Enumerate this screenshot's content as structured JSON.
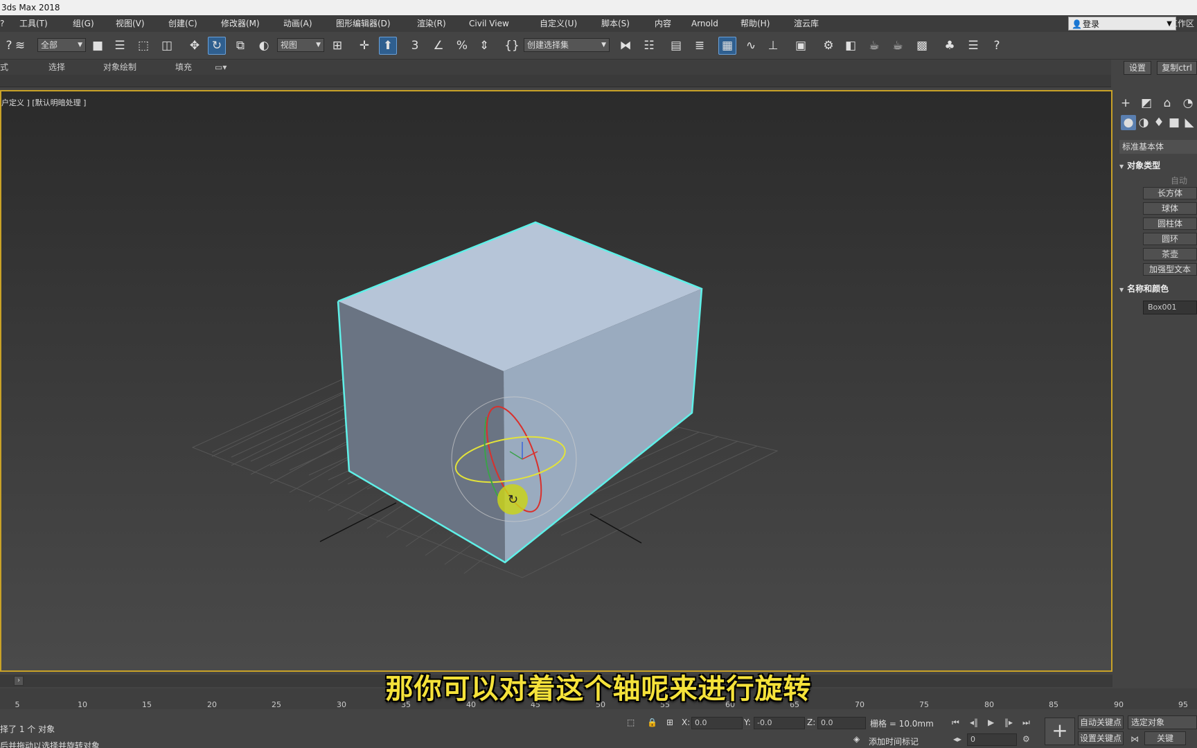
{
  "app": {
    "title": "3ds Max 2018"
  },
  "menu": [
    {
      "label": "工具(T)"
    },
    {
      "label": "组(G)"
    },
    {
      "label": "视图(V)"
    },
    {
      "label": "创建(C)"
    },
    {
      "label": "修改器(M)"
    },
    {
      "label": "动画(A)"
    },
    {
      "label": "图形编辑器(D)"
    },
    {
      "label": "渲染(R)"
    },
    {
      "label": "Civil View"
    },
    {
      "label": "自定义(U)"
    },
    {
      "label": "脚本(S)"
    },
    {
      "label": "内容"
    },
    {
      "label": "Arnold"
    },
    {
      "label": "帮助(H)"
    },
    {
      "label": "渲云库"
    }
  ],
  "account": {
    "login_label": "登录",
    "workspace_label": "工作区"
  },
  "toolbar": {
    "selection_filter": "全部",
    "ref_coord": "视图",
    "named_selection": "创建选择集"
  },
  "ribbon": {
    "tabs": [
      "式",
      "选择",
      "对象绘制",
      "填充"
    ],
    "settings_label": "设置",
    "copy_label": "复制ctrl"
  },
  "viewport": {
    "label": "户定义 ] [默认明暗处理 ]"
  },
  "command_panel": {
    "category": "标准基本体",
    "object_type_title": "对象类型",
    "autogrid_label": "自动",
    "objects": [
      "长方体",
      "球体",
      "圆柱体",
      "圆环",
      "茶壶",
      "加强型文本"
    ],
    "name_color_title": "名称和颜色",
    "object_name": "Box001"
  },
  "timeline": {
    "ticks": [
      "5",
      "10",
      "15",
      "20",
      "25",
      "30",
      "35",
      "40",
      "45",
      "50",
      "55",
      "60",
      "65",
      "70",
      "75",
      "80",
      "85",
      "90",
      "95"
    ]
  },
  "subtitle": "那你可以对着这个轴呢来进行旋转",
  "status": {
    "selected": "择了 1 个 对象",
    "prompt": "后并拖动以选择并旋转对象",
    "x_label": "X:",
    "x_value": "0.0",
    "y_label": "Y:",
    "y_value": "-0.0",
    "z_label": "Z:",
    "z_value": "0.0",
    "grid": "栅格 = 10.0mm",
    "add_time_tag": "添加时间标记",
    "auto_key": "自动关键点",
    "set_key": "设置关键点",
    "selected_object": "选定对象",
    "key_filters": "关键",
    "frame_value": "0"
  },
  "colors": {
    "viewport_border": "#c9a227",
    "selection_edge": "#5ff0e8",
    "subtitle": "#f5e23a",
    "active_tool": "#2f5f8f"
  }
}
